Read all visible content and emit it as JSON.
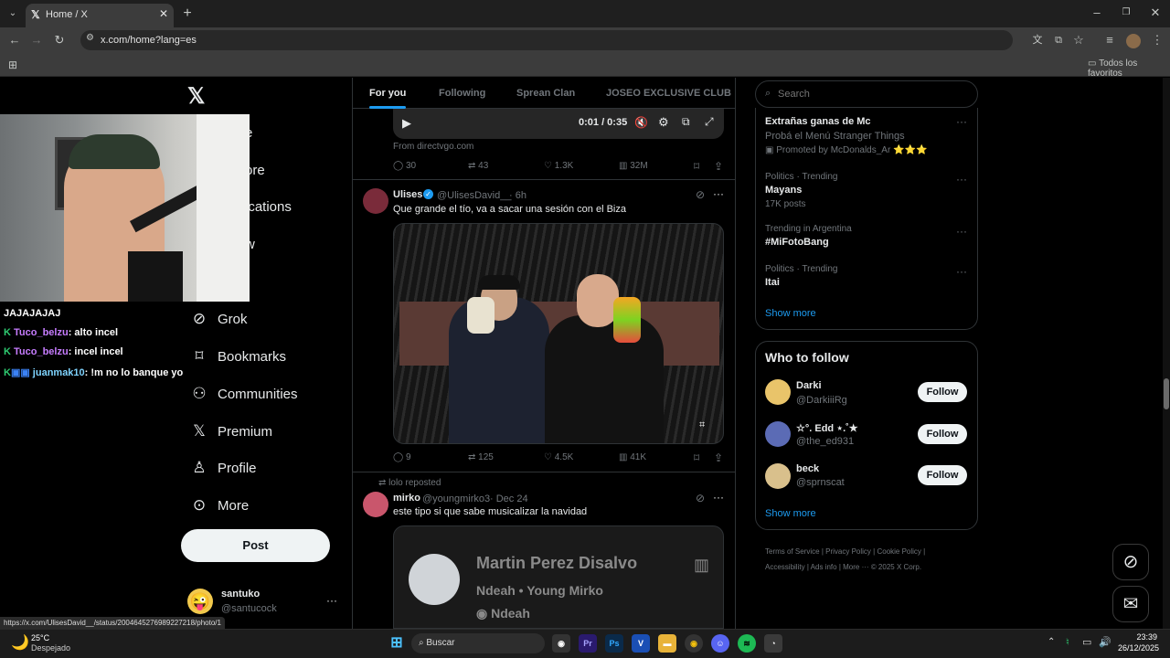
{
  "browser": {
    "tab_title": "Home / X",
    "url": "x.com/home?lang=es",
    "bookmarks_label": "Todos los favoritos",
    "status_url": "https://x.com/UlisesDavid__/status/2004645276989227218/photo/1"
  },
  "nav": {
    "grok": "Grok",
    "bookmarks": "Bookmarks",
    "communities": "Communities",
    "premium": "Premium",
    "profile": "Profile",
    "more": "More",
    "post_button": "Post",
    "partial_home": "e",
    "partial_explore": "ore",
    "partial_notifications": "ications",
    "partial_follow": "w",
    "account_name": "santuko",
    "account_handle": "@santucock"
  },
  "stream": {
    "title_text": "JAJAJAJAJ",
    "chat": [
      {
        "user": "Tuco_belzu",
        "message": ": alto incel",
        "color": "#c77dff"
      },
      {
        "user": "Tuco_belzu",
        "message": ": incel incel",
        "color": "#c77dff"
      },
      {
        "user": "juanmak10",
        "message": ": !m no lo banque yo",
        "color": "#7fd4ff"
      }
    ]
  },
  "timeline": {
    "tabs": [
      "For you",
      "Following",
      "Sprean Clan",
      "JOSEO EXCLUSIVE CLUB"
    ],
    "video": {
      "time": "0:01 / 0:35",
      "source": "From directvgo.com"
    },
    "stats1": {
      "replies": "30",
      "reposts": "43",
      "likes": "1.3K",
      "views": "32M"
    },
    "post2": {
      "name": "Ulises",
      "handle": "@UlisesDavid__",
      "time": "· 6h",
      "text": "Que grande el tío, va a sacar una sesión con el Biza",
      "replies": "9",
      "reposts": "125",
      "likes": "4.5K",
      "views": "41K"
    },
    "post3": {
      "reposted_by": "lolo reposted",
      "name": "mirko",
      "handle": "@youngmirko3",
      "time": "· Dec 24",
      "text": "este tipo si que sabe musicalizar la navidad",
      "card_title": "Martin Perez Disalvo",
      "card_sub": "Ndeah • Young Mirko",
      "card_album": "Ndeah"
    }
  },
  "sidebar": {
    "search_placeholder": "Search",
    "trends": [
      {
        "title": "Extrañas ganas de Mc",
        "sub": "Probá el Menú Stranger Things",
        "meta": "Promoted by McDonalds_Ar ⭐⭐⭐"
      },
      {
        "meta": "Politics · Trending",
        "title": "Mayans",
        "sub": "17K posts"
      },
      {
        "meta": "Trending in Argentina",
        "title": "#MiFotoBang",
        "sub": ""
      },
      {
        "meta": "Politics · Trending",
        "title": "Itai",
        "sub": ""
      }
    ],
    "show_more": "Show more",
    "who_to_follow": "Who to follow",
    "follow_users": [
      {
        "name": "Darki",
        "handle": "@DarkiiiRg",
        "button": "Follow"
      },
      {
        "name": "☆°. Edd ⋆.˚★",
        "handle": "@the_ed931",
        "button": "Follow"
      },
      {
        "name": "beck",
        "handle": "@sprnscat",
        "button": "Follow"
      }
    ],
    "show_more_2": "Show more",
    "footer": [
      "Terms of Service",
      "|",
      "Privacy Policy",
      "|",
      "Cookie Policy",
      "|",
      "Accessibility",
      "|",
      "Ads info",
      "|",
      "More ···",
      "© 2025 X Corp."
    ]
  },
  "taskbar": {
    "temperature": "25°C",
    "weather": "Despejado",
    "search": "Buscar",
    "time": "23:39",
    "date": "26/12/2025"
  }
}
